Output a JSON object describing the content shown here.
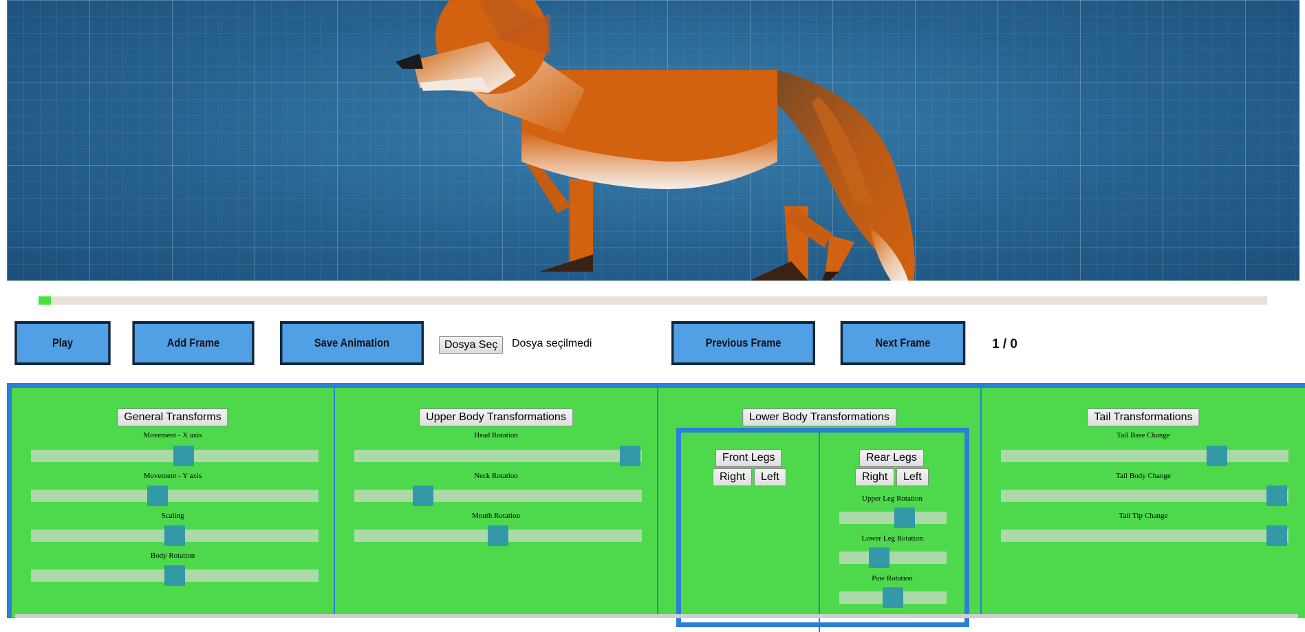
{
  "canvas": {
    "subject_icon": "fox-icon"
  },
  "progress": {
    "fraction": 0.01
  },
  "controls": {
    "play": "Play",
    "add_frame": "Add Frame",
    "save_animation": "Save Animation",
    "file_button": "Dosya Seç",
    "file_status": "Dosya seçilmedi",
    "previous_frame": "Previous Frame",
    "next_frame": "Next Frame",
    "frame_counter": "1 / 0"
  },
  "sections": {
    "general": {
      "title": "General Transforms",
      "sliders": [
        {
          "label": "Movement - X axis",
          "value": 0.53
        },
        {
          "label": "Movement - Y axis",
          "value": 0.44
        },
        {
          "label": "Scaling",
          "value": 0.5
        },
        {
          "label": "Body Rotation",
          "value": 0.5
        }
      ]
    },
    "upper": {
      "title": "Upper Body Transformations",
      "sliders": [
        {
          "label": "Head Rotation",
          "value": 0.96
        },
        {
          "label": "Neck Rotation",
          "value": 0.24
        },
        {
          "label": "Mouth Rotation",
          "value": 0.5
        }
      ]
    },
    "lower": {
      "title": "Lower Body Transformations",
      "front_legs": "Front Legs",
      "rear_legs": "Rear Legs",
      "right": "Right",
      "left": "Left",
      "sliders": [
        {
          "label": "Upper Leg Rotation",
          "value": 0.61
        },
        {
          "label": "Lower Leg Rotation",
          "value": 0.37
        },
        {
          "label": "Paw Rotation",
          "value": 0.5
        }
      ]
    },
    "tail": {
      "title": "Tail Transformations",
      "sliders": [
        {
          "label": "Tail Base Change",
          "value": 0.75
        },
        {
          "label": "Tail Body Change",
          "value": 0.96
        },
        {
          "label": "Tail Tip Change",
          "value": 0.96
        }
      ]
    }
  },
  "colors": {
    "canvas_bg": "#2f6d99",
    "fox_orange": "#d2620f",
    "button_blue": "#519fe4",
    "panel_green": "#4dd94b",
    "panel_border": "#2a7fd6",
    "slider_thumb": "#3399a6",
    "progress_fill": "#43e43c"
  }
}
